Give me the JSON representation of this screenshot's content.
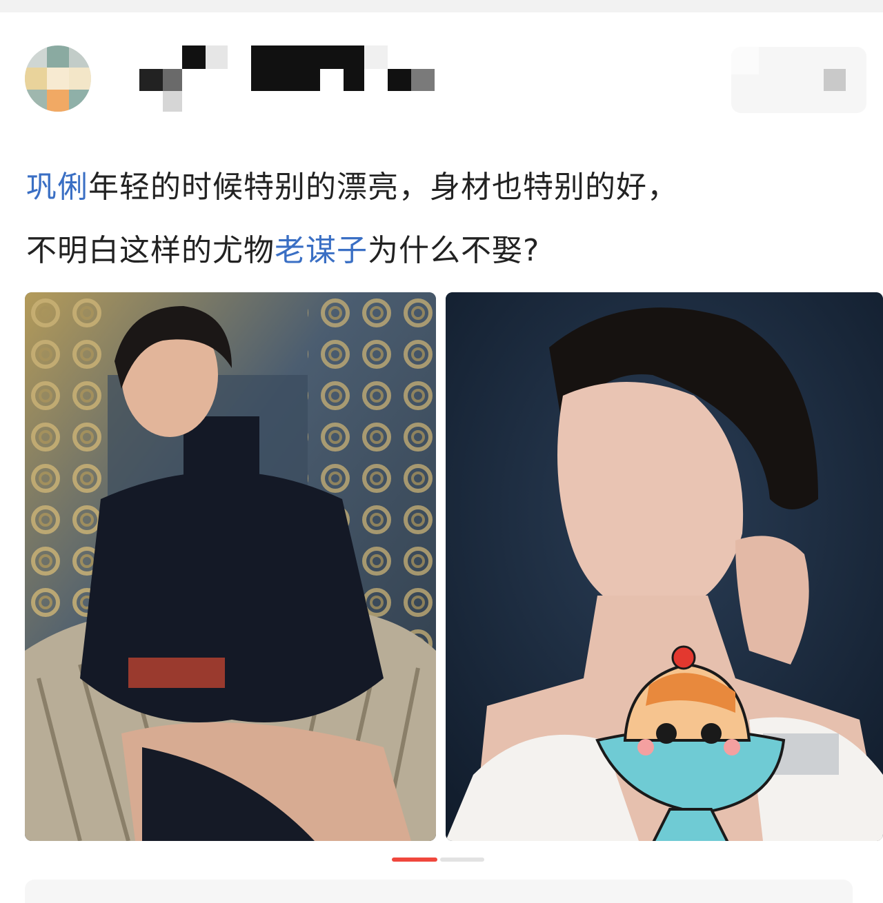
{
  "post": {
    "text_part1_link": "巩俐",
    "text_part2": "年轻的时候特别的漂亮，身材也特别的好，",
    "text_part3": "不明白这样的尤物",
    "text_part4_link": "老谋子",
    "text_part5": "为什么不娶?"
  },
  "header": {
    "avatar_icon": "pixelated-avatar",
    "more_icon": "blurred-menu"
  },
  "images": [
    {
      "alt": "",
      "icon": "photo-woman-in-wicker-chair"
    },
    {
      "alt": "",
      "icon": "photo-woman-white-dress"
    }
  ],
  "pagination": {
    "current": 1,
    "total": 2
  },
  "colors": {
    "link": "#3a6fc4",
    "indicator_active": "#f0473d",
    "indicator_inactive": "#e2e2e2"
  }
}
